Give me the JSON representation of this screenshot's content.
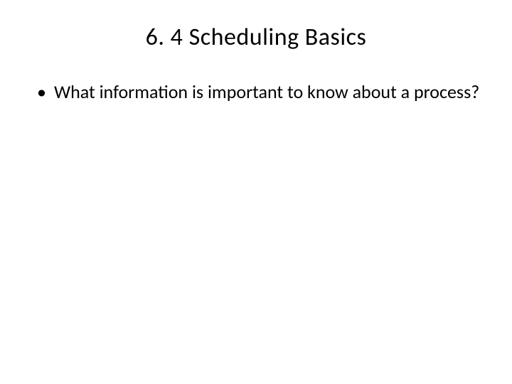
{
  "slide": {
    "title": "6. 4 Scheduling Basics",
    "bullets": [
      "What information is important to know about a process?"
    ]
  }
}
